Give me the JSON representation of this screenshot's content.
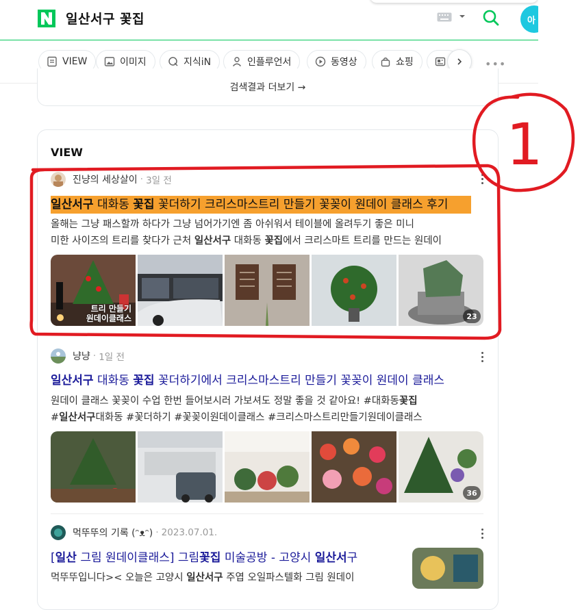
{
  "header": {
    "logo_letter": "N",
    "query": "일산서구 꽃집",
    "avatar_text": "아",
    "brand_color": "#03c75a"
  },
  "tabs": [
    {
      "label": "VIEW",
      "icon": "view-icon"
    },
    {
      "label": "이미지",
      "icon": "image-icon"
    },
    {
      "label": "지식iN",
      "icon": "qna-icon"
    },
    {
      "label": "인플루언서",
      "icon": "person-icon"
    },
    {
      "label": "동영상",
      "icon": "play-icon"
    },
    {
      "label": "쇼핑",
      "icon": "bag-icon"
    },
    {
      "label": "",
      "icon": "news-icon"
    }
  ],
  "tabs_more": "•••",
  "prev_section": {
    "more_results": "검색결과 더보기 →"
  },
  "view": {
    "heading": "VIEW",
    "items": [
      {
        "author": "진냥의 세상살이",
        "date": "3일 전",
        "title_parts": [
          "일산서구",
          " 대화동 ",
          "꽃집",
          " 꽃더하기 크리스마스트리 만들기 꽃꽂이 원데이 클래스 후기"
        ],
        "snippet_line1": "올해는 그냥 패스할까 하다가 그냥 넘어가기엔 좀 아쉬워서 테이블에 올려두기 좋은 미니",
        "snippet_line2_parts": [
          "미한 사이즈의 트리를 찾다가 근처 ",
          "일산서구",
          " 대화동 ",
          "꽃집",
          "에서 크리스마트 트리를 만드는 원데이"
        ],
        "thumb_caption": "트리 만들기\n원데이클래스",
        "photo_count": "23"
      },
      {
        "author": "냥냥",
        "date": "1일 전",
        "title_parts": [
          "일산서구",
          " 대화동 ",
          "꽃집",
          " 꽃더하기에서 크리스마스트리 만들기 꽃꽂이 원데이 클래스"
        ],
        "snippet_line1_parts": [
          "원데이 클래스 꽃꽂이 수업 한번 들어보시러 가보셔도 정말 좋을 것 같아요! #대화동",
          "꽃집"
        ],
        "snippet_line2_parts": [
          "#",
          "일산서구",
          "대화동 #꽃더하기 #꽃꽂이원데이클래스 #크리스마스트리만들기원데이클래스"
        ],
        "photo_count": "36"
      },
      {
        "author": "먹뚜뚜의 기록 (ᵔᴥᵔ)",
        "date": "2023.07.01.",
        "title_parts": [
          "[",
          "일산",
          " 그림 원데이클래스] 그림",
          "꽃집",
          " 미술공방 - 고양시 ",
          "일산서",
          "구"
        ],
        "snippet_parts": [
          "먹뚜뚜입니다>< 오늘은 고양시 ",
          "일산서구",
          " 주엽 오일파스텔화 그림 원데이"
        ]
      }
    ]
  },
  "annotation": {
    "label": "1",
    "color": "#e11b22"
  }
}
